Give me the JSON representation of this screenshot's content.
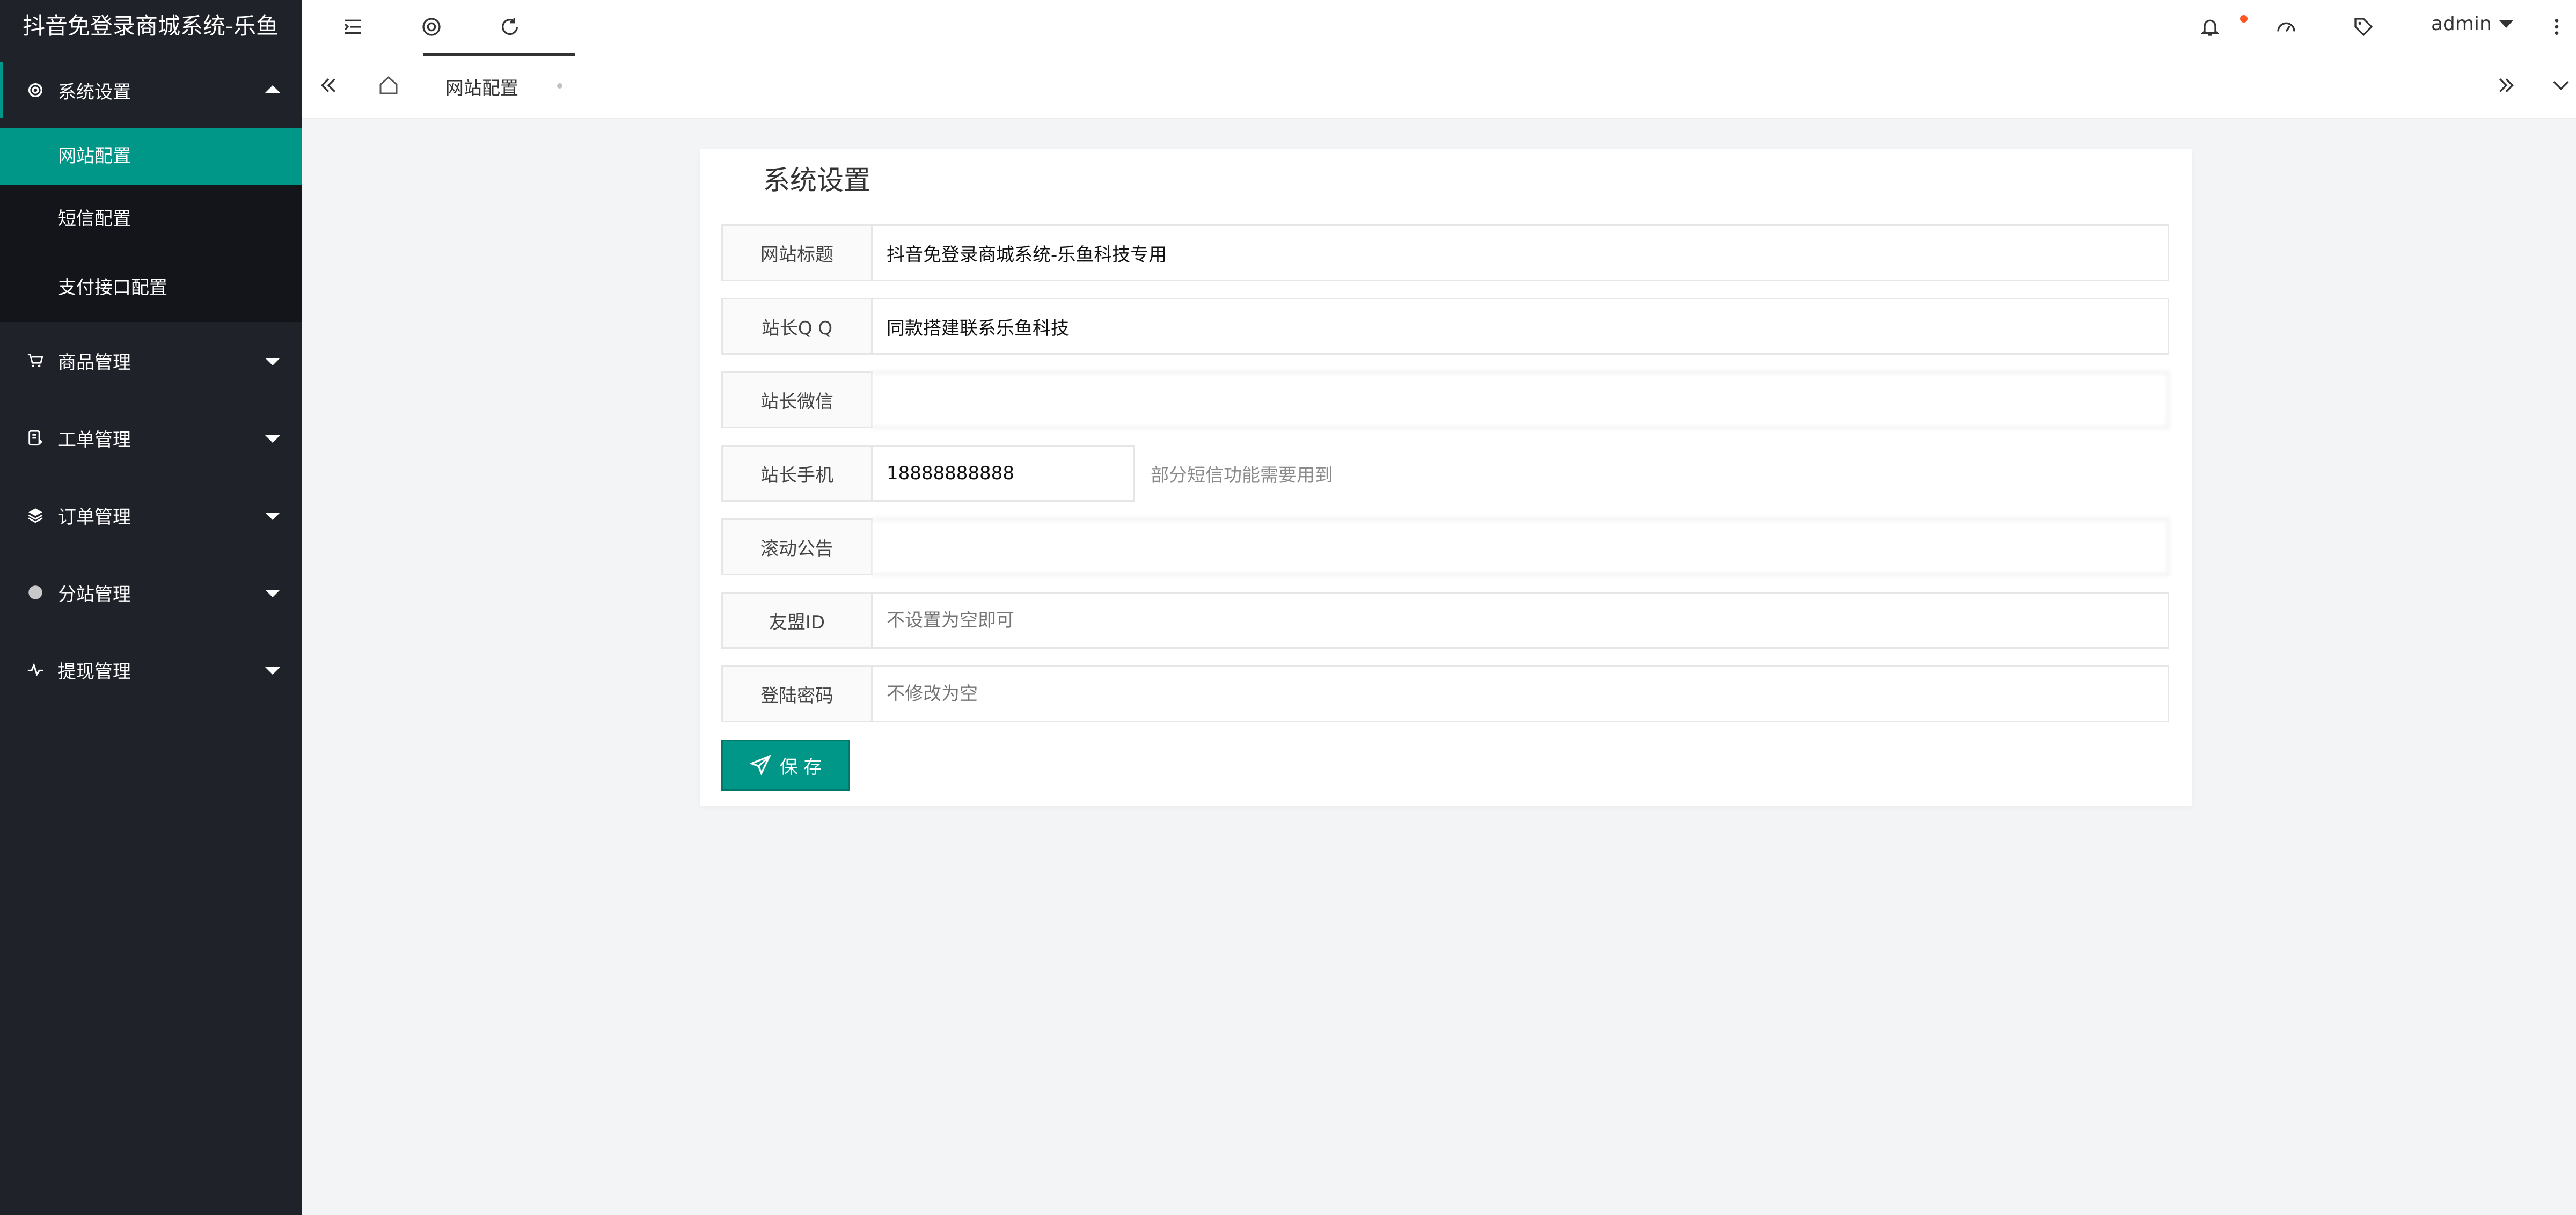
{
  "app": {
    "title": "抖音免登录商城系统-乐鱼"
  },
  "header": {
    "user": "admin",
    "icons": [
      "menu-fold-icon",
      "theme-icon",
      "refresh-icon",
      "bell-icon",
      "dashboard-icon",
      "tag-icon",
      "more-vertical-icon"
    ]
  },
  "sidebar": {
    "groups": [
      {
        "label": "系统设置",
        "icon": "gear-icon",
        "expanded": true,
        "children": [
          {
            "label": "网站配置",
            "active": true
          },
          {
            "label": "短信配置",
            "active": false
          },
          {
            "label": "支付接口配置",
            "active": false
          }
        ]
      },
      {
        "label": "商品管理",
        "icon": "cart-icon",
        "expanded": false
      },
      {
        "label": "工单管理",
        "icon": "ticket-icon",
        "expanded": false
      },
      {
        "label": "订单管理",
        "icon": "stack-icon",
        "expanded": false
      },
      {
        "label": "分站管理",
        "icon": "circle-icon",
        "expanded": false
      },
      {
        "label": "提现管理",
        "icon": "pulse-icon",
        "expanded": false
      }
    ]
  },
  "tabs": {
    "active": "网站配置"
  },
  "form": {
    "title": "系统设置",
    "fields": [
      {
        "label": "网站标题",
        "value": "抖音免登录商城系统-乐鱼科技专用",
        "placeholder": "",
        "hint": ""
      },
      {
        "label": "站长Q Q",
        "value": "同款搭建联系乐鱼科技",
        "placeholder": "",
        "hint": ""
      },
      {
        "label": "站长微信",
        "value": "",
        "placeholder": "",
        "hint": ""
      },
      {
        "label": "站长手机",
        "value": "18888888888",
        "placeholder": "",
        "hint": "部分短信功能需要用到"
      },
      {
        "label": "滚动公告",
        "value": "",
        "placeholder": "",
        "hint": ""
      },
      {
        "label": "友盟ID",
        "value": "",
        "placeholder": "不设置为空即可",
        "hint": ""
      },
      {
        "label": "登陆密码",
        "value": "",
        "placeholder": "不修改为空",
        "hint": ""
      }
    ],
    "save_label": "保 存"
  },
  "colors": {
    "accent": "#009688",
    "sidebar_bg": "#20222a",
    "submenu_bg": "#13151a",
    "badge": "#ff5722"
  }
}
